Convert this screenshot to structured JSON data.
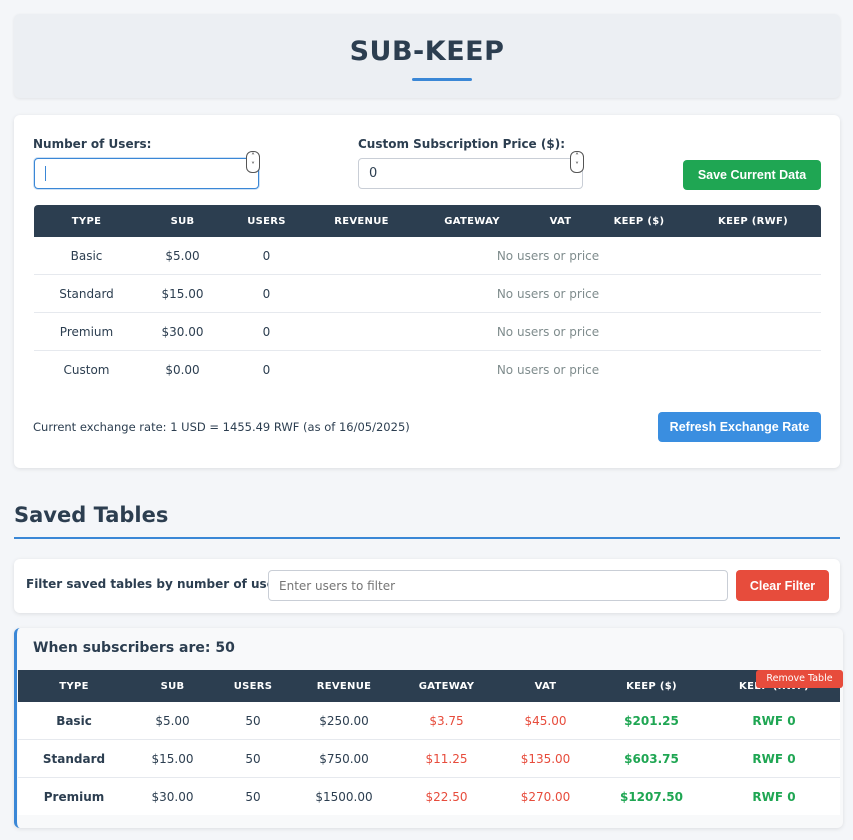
{
  "app": {
    "title": "SUB-KEEP"
  },
  "form": {
    "users_label": "Number of Users:",
    "users_value": "",
    "price_label": "Custom Subscription Price ($):",
    "price_value": "0",
    "save_label": "Save Current Data"
  },
  "main_table": {
    "headers": [
      "TYPE",
      "SUB",
      "USERS",
      "REVENUE",
      "GATEWAY",
      "VAT",
      "KEEP ($)",
      "KEEP (RWF)"
    ],
    "rows": [
      {
        "type": "Basic",
        "sub": "$5.00",
        "users": "0",
        "message": "No users or price"
      },
      {
        "type": "Standard",
        "sub": "$15.00",
        "users": "0",
        "message": "No users or price"
      },
      {
        "type": "Premium",
        "sub": "$30.00",
        "users": "0",
        "message": "No users or price"
      },
      {
        "type": "Custom",
        "sub": "$0.00",
        "users": "0",
        "message": "No users or price"
      }
    ]
  },
  "exchange": {
    "text": "Current exchange rate: 1 USD = 1455.49 RWF (as of 16/05/2025)",
    "refresh_label": "Refresh Exchange Rate"
  },
  "saved": {
    "section_title": "Saved Tables",
    "filter_label": "Filter saved tables by number of users:",
    "filter_placeholder": "Enter users to filter",
    "clear_label": "Clear Filter",
    "tables": [
      {
        "title": "When subscribers are: 50",
        "remove_label": "Remove Table",
        "headers": [
          "TYPE",
          "SUB",
          "USERS",
          "REVENUE",
          "GATEWAY",
          "VAT",
          "KEEP ($)",
          "KEEP (RWF)"
        ],
        "rows": [
          {
            "type": "Basic",
            "sub": "$5.00",
            "users": "50",
            "revenue": "$250.00",
            "gateway": "$3.75",
            "vat": "$45.00",
            "keep_usd": "$201.25",
            "keep_rwf": "RWF 0"
          },
          {
            "type": "Standard",
            "sub": "$15.00",
            "users": "50",
            "revenue": "$750.00",
            "gateway": "$11.25",
            "vat": "$135.00",
            "keep_usd": "$603.75",
            "keep_rwf": "RWF 0"
          },
          {
            "type": "Premium",
            "sub": "$30.00",
            "users": "50",
            "revenue": "$1500.00",
            "gateway": "$22.50",
            "vat": "$270.00",
            "keep_usd": "$1207.50",
            "keep_rwf": "RWF 0"
          }
        ]
      }
    ]
  },
  "colors": {
    "accent": "#3a87d6",
    "header_dark": "#2c3e50",
    "green": "#1fa653",
    "red": "#e74c3c"
  },
  "icons": {
    "spinner": "spinner-arrows-icon"
  }
}
